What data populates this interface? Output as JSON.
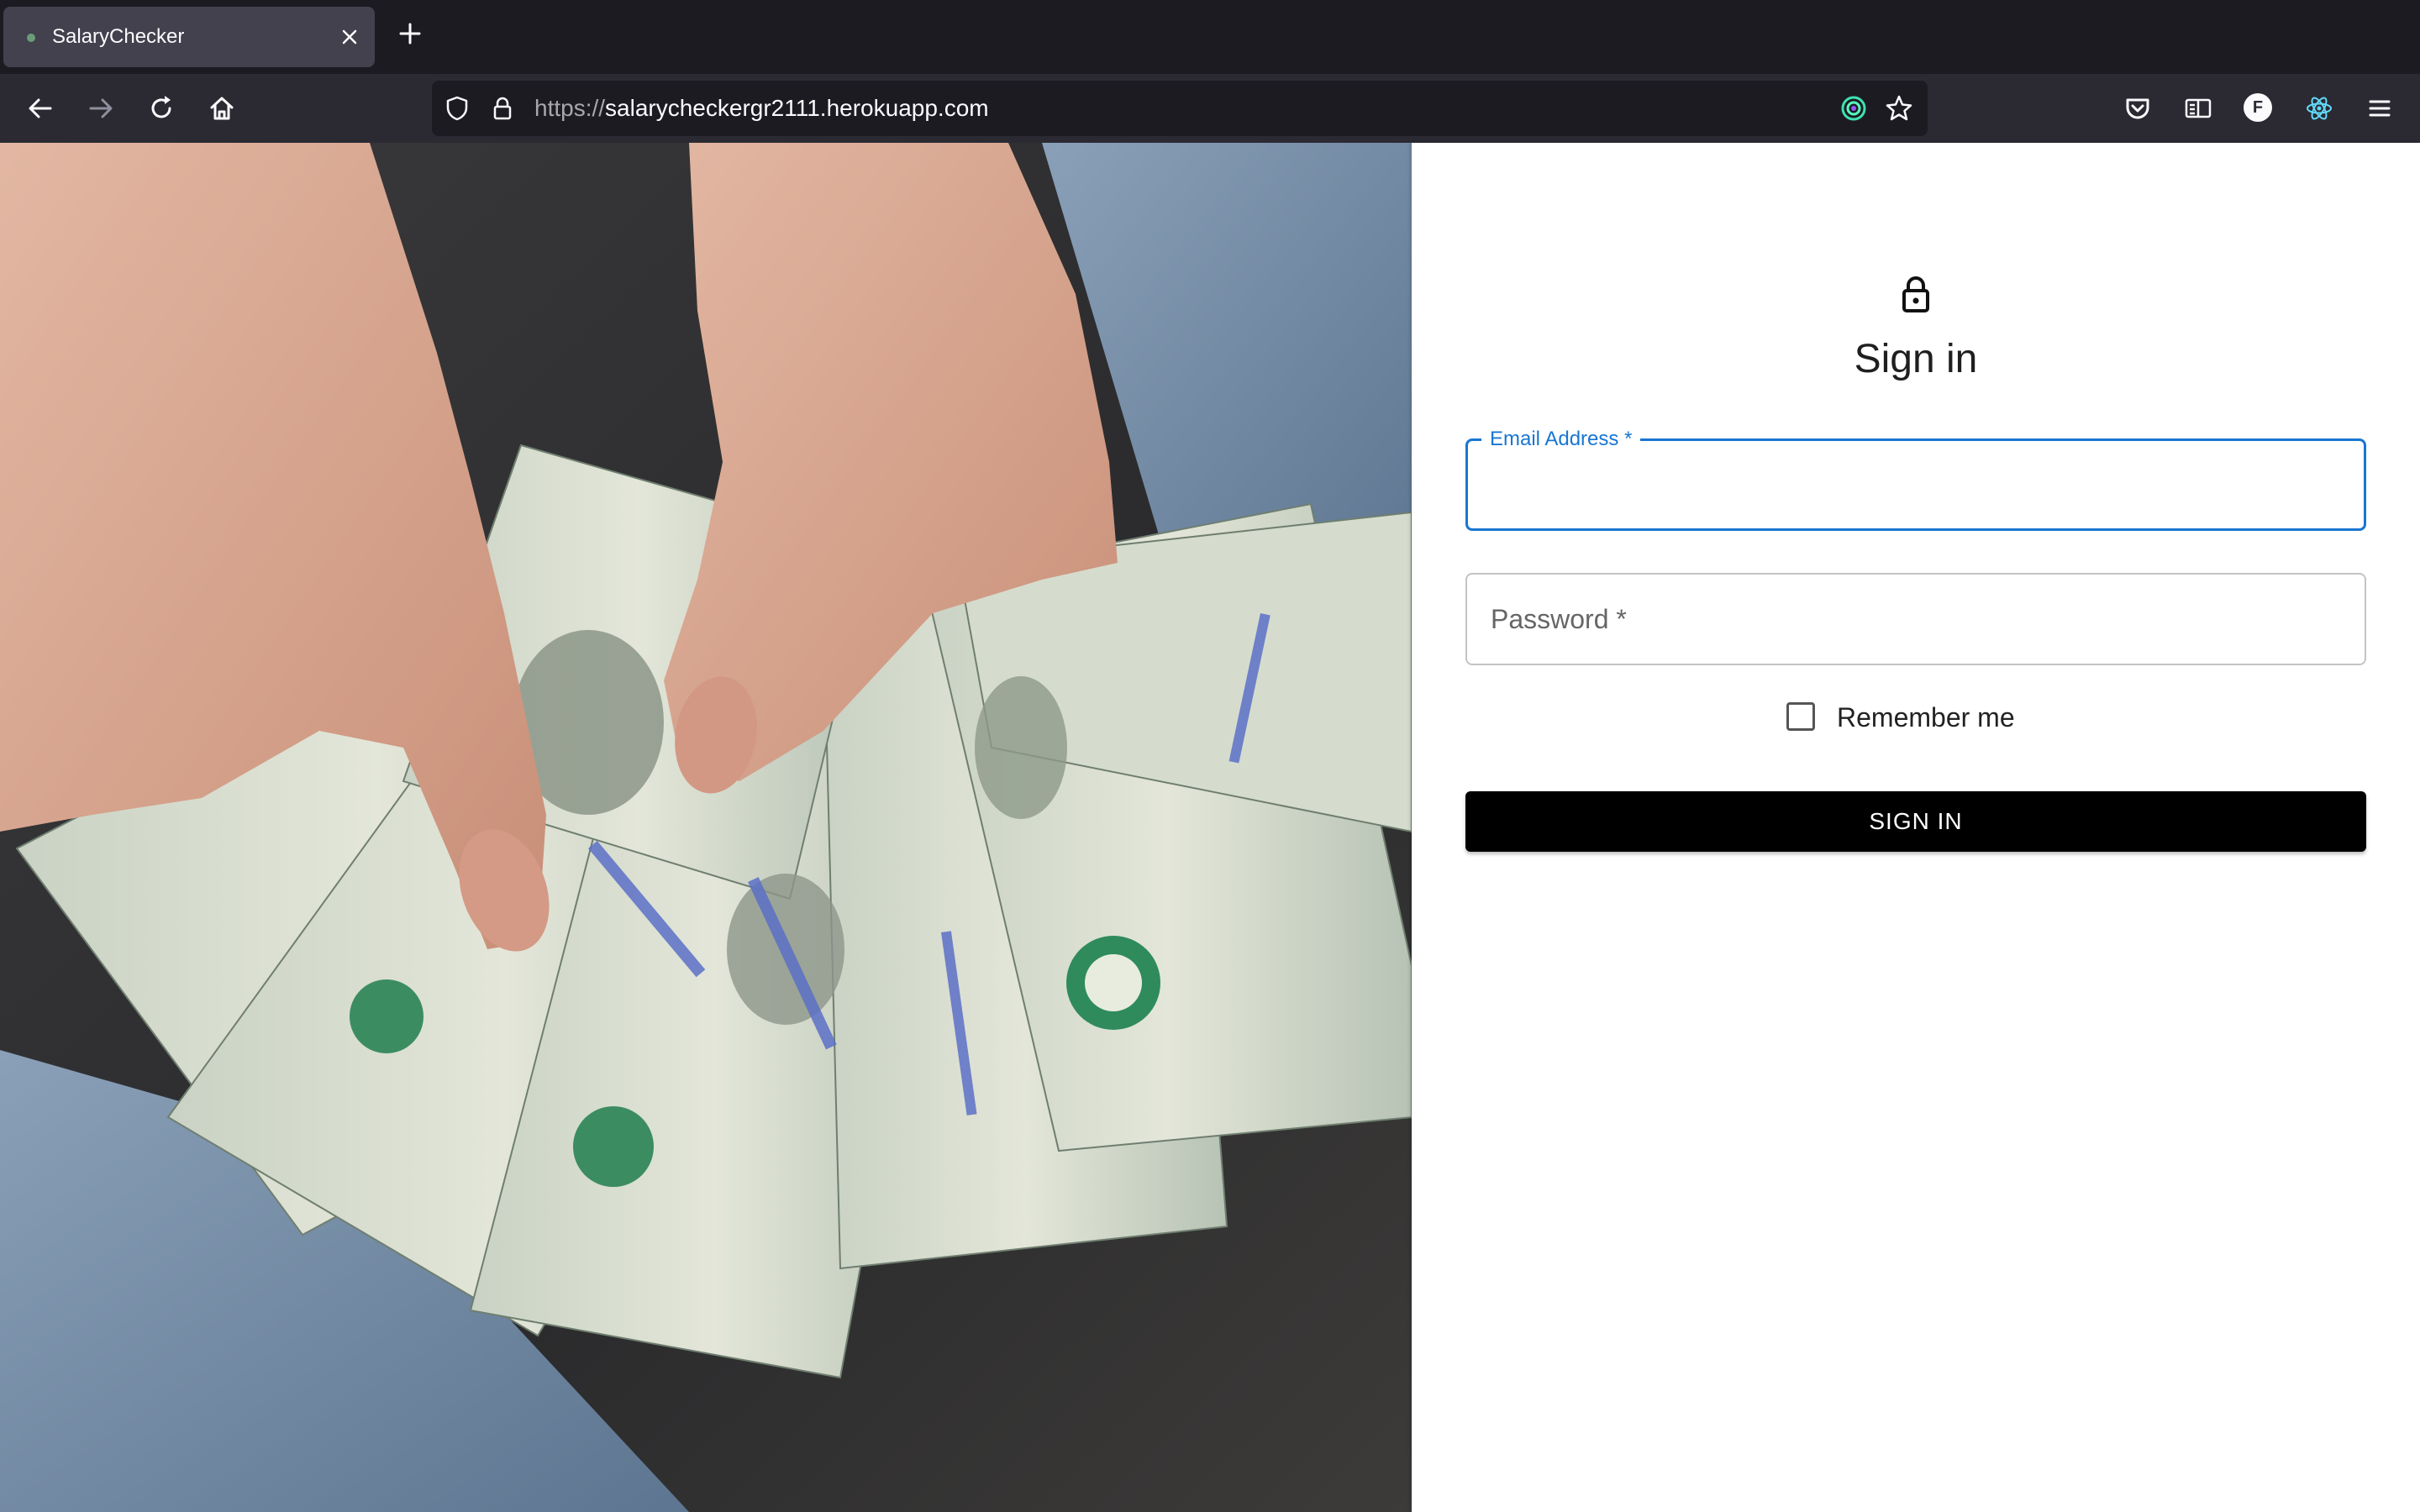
{
  "browser": {
    "tab": {
      "title": "SalaryChecker"
    },
    "url": {
      "scheme": "https://",
      "host": "salarycheckergr2111.herokuapp.com"
    }
  },
  "signin": {
    "title": "Sign in",
    "email_label": "Email Address *",
    "email_value": "",
    "password_label": "Password *",
    "password_value": "",
    "remember_label": "Remember me",
    "remember_checked": false,
    "button_label": "SIGN IN"
  },
  "colors": {
    "primary": "#1976d2",
    "button": "#000000",
    "chrome_dark": "#1c1b22",
    "chrome_toolbar": "#2b2a33"
  },
  "icons": {
    "tab_close": "close-icon",
    "new_tab": "plus-icon",
    "back": "arrow-left-icon",
    "forward": "arrow-right-icon",
    "reload": "reload-icon",
    "home": "home-icon",
    "tracking": "shield-icon",
    "secure": "padlock-icon",
    "extension": "green-circle-icon",
    "bookmark": "star-icon",
    "pocket": "pocket-icon",
    "reader": "reader-view-icon",
    "account": "account-f-icon",
    "react": "react-devtools-icon",
    "menu": "hamburger-menu-icon",
    "signin": "lock-icon"
  },
  "hero_image": {
    "subject": "hands-holding-hundred-dollar-bills"
  }
}
